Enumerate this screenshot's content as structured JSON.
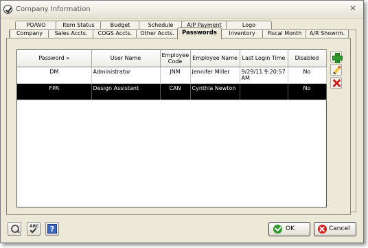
{
  "window": {
    "title": "Company Information"
  },
  "tabs": {
    "row1": [
      "PO/WO",
      "Item Status",
      "Budget",
      "Schedule",
      "A/P Payment",
      "Logo"
    ],
    "row2": [
      "Company",
      "Sales Accts.",
      "COGS Accts.",
      "Other Accts.",
      "Passwords",
      "Inventory",
      "Fiscal Month",
      "A/R Showrm."
    ],
    "active": "Passwords"
  },
  "table": {
    "columns": [
      "Password »",
      "User Name",
      "Employee Code",
      "Employee Name",
      "Last Login Time",
      "Disabled"
    ],
    "rows": [
      {
        "password": "DM",
        "user_name": "Administrator",
        "employee_code": "JNM",
        "employee_name": "Jennifer Miller",
        "last_login": "9/29/11 9:20:57 AM",
        "disabled": "No",
        "selected": false
      },
      {
        "password": "FPA",
        "user_name": "Design Assistant",
        "employee_code": "CAN",
        "employee_name": "Cynthia Newton",
        "last_login": "",
        "disabled": "No",
        "selected": true
      }
    ]
  },
  "side_actions": [
    "plus-icon",
    "pencil-icon",
    "x-icon"
  ],
  "footer": {
    "ok_label": "OK",
    "cancel_label": "Cancel"
  },
  "colors": {
    "selected_row_bg": "#000000",
    "selected_row_text": "#ffffff",
    "dialog_bg": "#ece9d8"
  }
}
